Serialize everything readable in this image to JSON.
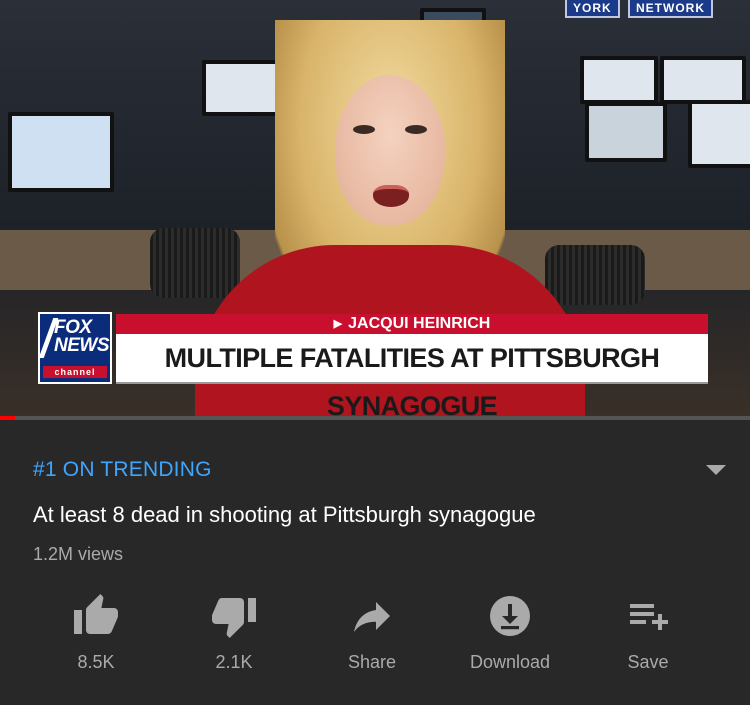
{
  "video": {
    "studio_sign": "NETWORK",
    "studio_sign_left": "YORK",
    "lower_third": {
      "logo_line1": "FOX",
      "logo_line2": "NEWS",
      "logo_channel": "channel",
      "reporter": "JACQUI HEINRICH",
      "headline": "MULTIPLE FATALITIES AT PITTSBURGH SYNAGOGUE"
    },
    "progress_fraction": 0.02
  },
  "info": {
    "trending": "#1 ON TRENDING",
    "title": "At least 8 dead in shooting at Pittsburgh synagogue",
    "views": "1.2M views"
  },
  "actions": [
    {
      "label": "8.5K",
      "icon": "thumbs-up-icon"
    },
    {
      "label": "2.1K",
      "icon": "thumbs-down-icon"
    },
    {
      "label": "Share",
      "icon": "share-icon"
    },
    {
      "label": "Download",
      "icon": "download-icon"
    },
    {
      "label": "Save",
      "icon": "playlist-add-icon"
    }
  ],
  "colors": {
    "background": "#282828",
    "accent_blue": "#3ea6ff",
    "progress_red": "#ff0000",
    "fox_red": "#c8102e",
    "fox_blue": "#0a2c7a"
  }
}
